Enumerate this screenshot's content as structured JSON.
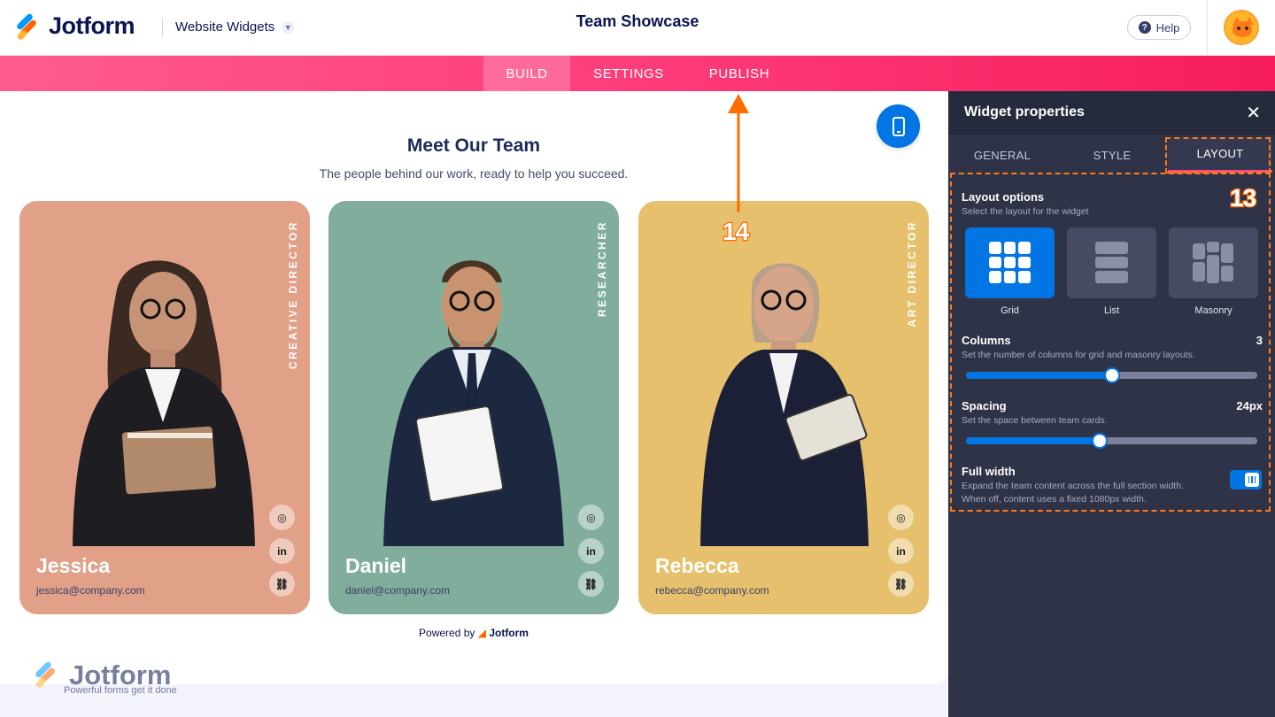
{
  "header": {
    "logo_text": "Jotform",
    "app_switch": "Website Widgets",
    "title": "Team Showcase",
    "help_label": "Help"
  },
  "nav": {
    "tabs": [
      {
        "label": "BUILD",
        "active": true
      },
      {
        "label": "SETTINGS",
        "active": false
      },
      {
        "label": "PUBLISH",
        "active": false
      }
    ]
  },
  "widget": {
    "title": "Meet Our Team",
    "subtitle": "The people behind our work, ready to help you succeed.",
    "members": [
      {
        "name": "Jessica",
        "role": "CREATIVE DIRECTOR",
        "email": "jessica@company.com",
        "color": "#e0a188"
      },
      {
        "name": "Daniel",
        "role": "RESEARCHER",
        "email": "daniel@company.com",
        "color": "#80ad9c"
      },
      {
        "name": "Rebecca",
        "role": "ART DIRECTOR",
        "email": "rebecca@company.com",
        "color": "#e6c06c"
      }
    ],
    "social_icons": [
      "instagram-icon",
      "linkedin-icon",
      "link-icon"
    ],
    "linkedin_glyph": "in",
    "powered_prefix": "Powered by",
    "powered_brand": "Jotform"
  },
  "watermark": {
    "brand": "Jotform",
    "tagline": "Powerful forms get it done"
  },
  "panel": {
    "title": "Widget properties",
    "tabs": [
      {
        "label": "GENERAL",
        "active": false
      },
      {
        "label": "STYLE",
        "active": false
      },
      {
        "label": "LAYOUT",
        "active": true
      }
    ],
    "layout_options": {
      "label": "Layout options",
      "description": "Select the layout for the widget",
      "options": [
        {
          "label": "Grid",
          "selected": true
        },
        {
          "label": "List",
          "selected": false
        },
        {
          "label": "Masonry",
          "selected": false
        }
      ]
    },
    "columns": {
      "label": "Columns",
      "description": "Set the number of columns for grid and masonry layouts.",
      "value": "3",
      "slider_fraction": 0.5
    },
    "spacing": {
      "label": "Spacing",
      "description": "Set the space between team cards.",
      "value": "24px",
      "slider_fraction": 0.46
    },
    "full_width": {
      "label": "Full width",
      "description_line1": "Expand the team content across the full section width.",
      "description_line2": "When off, content uses a fixed 1080px width.",
      "enabled": true
    }
  },
  "annotations": {
    "step_13": "13",
    "step_14": "14",
    "accent_color": "#ff6d00"
  }
}
